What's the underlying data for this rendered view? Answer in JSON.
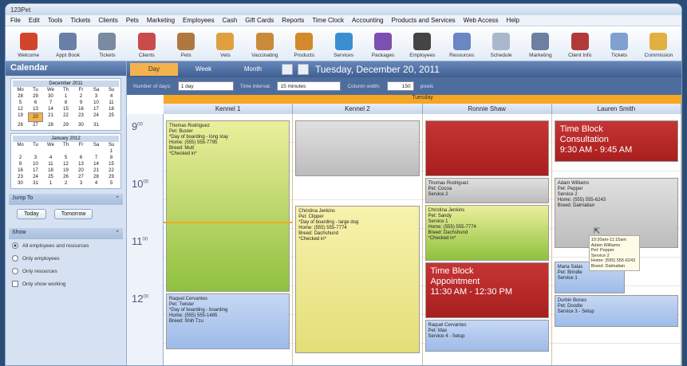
{
  "window": {
    "title": "123Pet"
  },
  "menu": [
    "File",
    "Edit",
    "Tools",
    "Tickets",
    "Clients",
    "Pets",
    "Marketing",
    "Employees",
    "Cash",
    "Gift Cards",
    "Reports",
    "Time Clock",
    "Accounting",
    "Products and Services",
    "Web Access",
    "Help"
  ],
  "toolbar": [
    {
      "label": "Welcome",
      "color": "#d2452a"
    },
    {
      "label": "Appt Book",
      "color": "#6a7fa8"
    },
    {
      "label": "Tickets",
      "color": "#7a8aa0"
    },
    {
      "label": "Clients",
      "color": "#c94b4b"
    },
    {
      "label": "Pets",
      "color": "#b07840"
    },
    {
      "label": "Vets",
      "color": "#e0a040"
    },
    {
      "label": "Vaccinating",
      "color": "#c98b3a"
    },
    {
      "label": "Products",
      "color": "#d28a2a"
    },
    {
      "label": "Services",
      "color": "#3b8fd0"
    },
    {
      "label": "Packages",
      "color": "#7c4fb0"
    },
    {
      "label": "Employees",
      "color": "#444"
    },
    {
      "label": "Resources",
      "color": "#6c86c4"
    },
    {
      "label": "Schedule",
      "color": "#aab7cc"
    },
    {
      "label": "Marketing",
      "color": "#6f7fa1"
    },
    {
      "label": "Client Info",
      "color": "#b03a3a"
    },
    {
      "label": "Tickets",
      "color": "#7fa0d0"
    },
    {
      "label": "Commission",
      "color": "#e0b040"
    }
  ],
  "sidebar": {
    "title": "Calendar",
    "month1": {
      "title": "December 2011",
      "days": [
        "Mo",
        "Tu",
        "We",
        "Th",
        "Fr",
        "Sa",
        "Su"
      ],
      "rows": [
        [
          "28",
          "29",
          "30",
          "1",
          "2",
          "3",
          "4"
        ],
        [
          "5",
          "6",
          "7",
          "8",
          "9",
          "10",
          "11"
        ],
        [
          "12",
          "13",
          "14",
          "15",
          "16",
          "17",
          "18"
        ],
        [
          "19",
          "20",
          "21",
          "22",
          "23",
          "24",
          "25"
        ],
        [
          "26",
          "27",
          "28",
          "29",
          "30",
          "31",
          ""
        ]
      ]
    },
    "month2": {
      "title": "January 2012",
      "days": [
        "Mo",
        "Tu",
        "We",
        "Th",
        "Fr",
        "Sa",
        "Su"
      ],
      "rows": [
        [
          "",
          "",
          "",
          "",
          "",
          "",
          "1"
        ],
        [
          "2",
          "3",
          "4",
          "5",
          "6",
          "7",
          "8"
        ],
        [
          "9",
          "10",
          "11",
          "12",
          "13",
          "14",
          "15"
        ],
        [
          "16",
          "17",
          "18",
          "19",
          "20",
          "21",
          "22"
        ],
        [
          "23",
          "24",
          "25",
          "26",
          "27",
          "28",
          "29"
        ],
        [
          "30",
          "31",
          "1",
          "2",
          "3",
          "4",
          "5"
        ]
      ]
    },
    "jump_to": "Jump To",
    "today": "Today",
    "tomorrow": "Tomorrow",
    "show": "Show",
    "options": [
      "All employees and resources",
      "Only employees",
      "Only resources"
    ],
    "working": "Only show working"
  },
  "view": {
    "tabs": [
      "Day",
      "Week",
      "Month"
    ],
    "date": "Tuesday, December 20, 2011",
    "days_label": "Number of days:",
    "days_value": "1 day",
    "interval_label": "Time interval:",
    "interval_value": "15 minutes",
    "width_label": "Column width:",
    "width_value": "150",
    "width_unit": "pixels",
    "day_header": "Tuesday",
    "columns": [
      "Kennel 1",
      "Kennel 2",
      "Ronnie Shaw",
      "Lauren Smith"
    ],
    "times": [
      "9",
      "10",
      "11",
      "12"
    ]
  },
  "appointments": {
    "k1a": "Thomas Rodriguez\nPet: Buster\n*Day of boarding - long stay\nHome: (555) 555-7795\nBreed: Mutt\n*Checked in*",
    "k1b": "Raquel Cervantes\nPet: Twister\n*Day of boarding - boarding\nHome: (555) 555-1485\nBreed: Shih Tzu",
    "k2b": "Christina Jenkins\nPet: Clipper\n*Day of boarding - large dog\nHome: (555) 555-7774\nBreed: Dachshund\n*Checked in*",
    "r1": "Thomas Rodriguez\nPet: Cocoa\nService 2",
    "r2": "Christina Jenkins\nPet: Sandy\nService 1\nHome: (555) 555-7774\nBreed: Dachshund\n*Checked in*",
    "r3": "Time Block\nAppointment\n11:30 AM - 12:30 PM",
    "r4": "Raquel Cervantes\nPet: Max\nService 4 - Setup",
    "l1": "Time Block\nConsultation\n9:30 AM - 9:45 AM",
    "l2": "Adam Williams\nPet: Pepper\nService 2\nHome: (555) 555-6243\nBreed: Dalmatian",
    "l3": "Maria Salas\nPet: Brindle\nService 1",
    "l4": "Durbin Bones\nPet: Doodle\nService 3 - Setup",
    "tip": "10:30am-11:15am\nAdam Williams\nPet: Pepper\nService 2\nHome: (555) 555-6243\nBreed: Dalmatian"
  }
}
